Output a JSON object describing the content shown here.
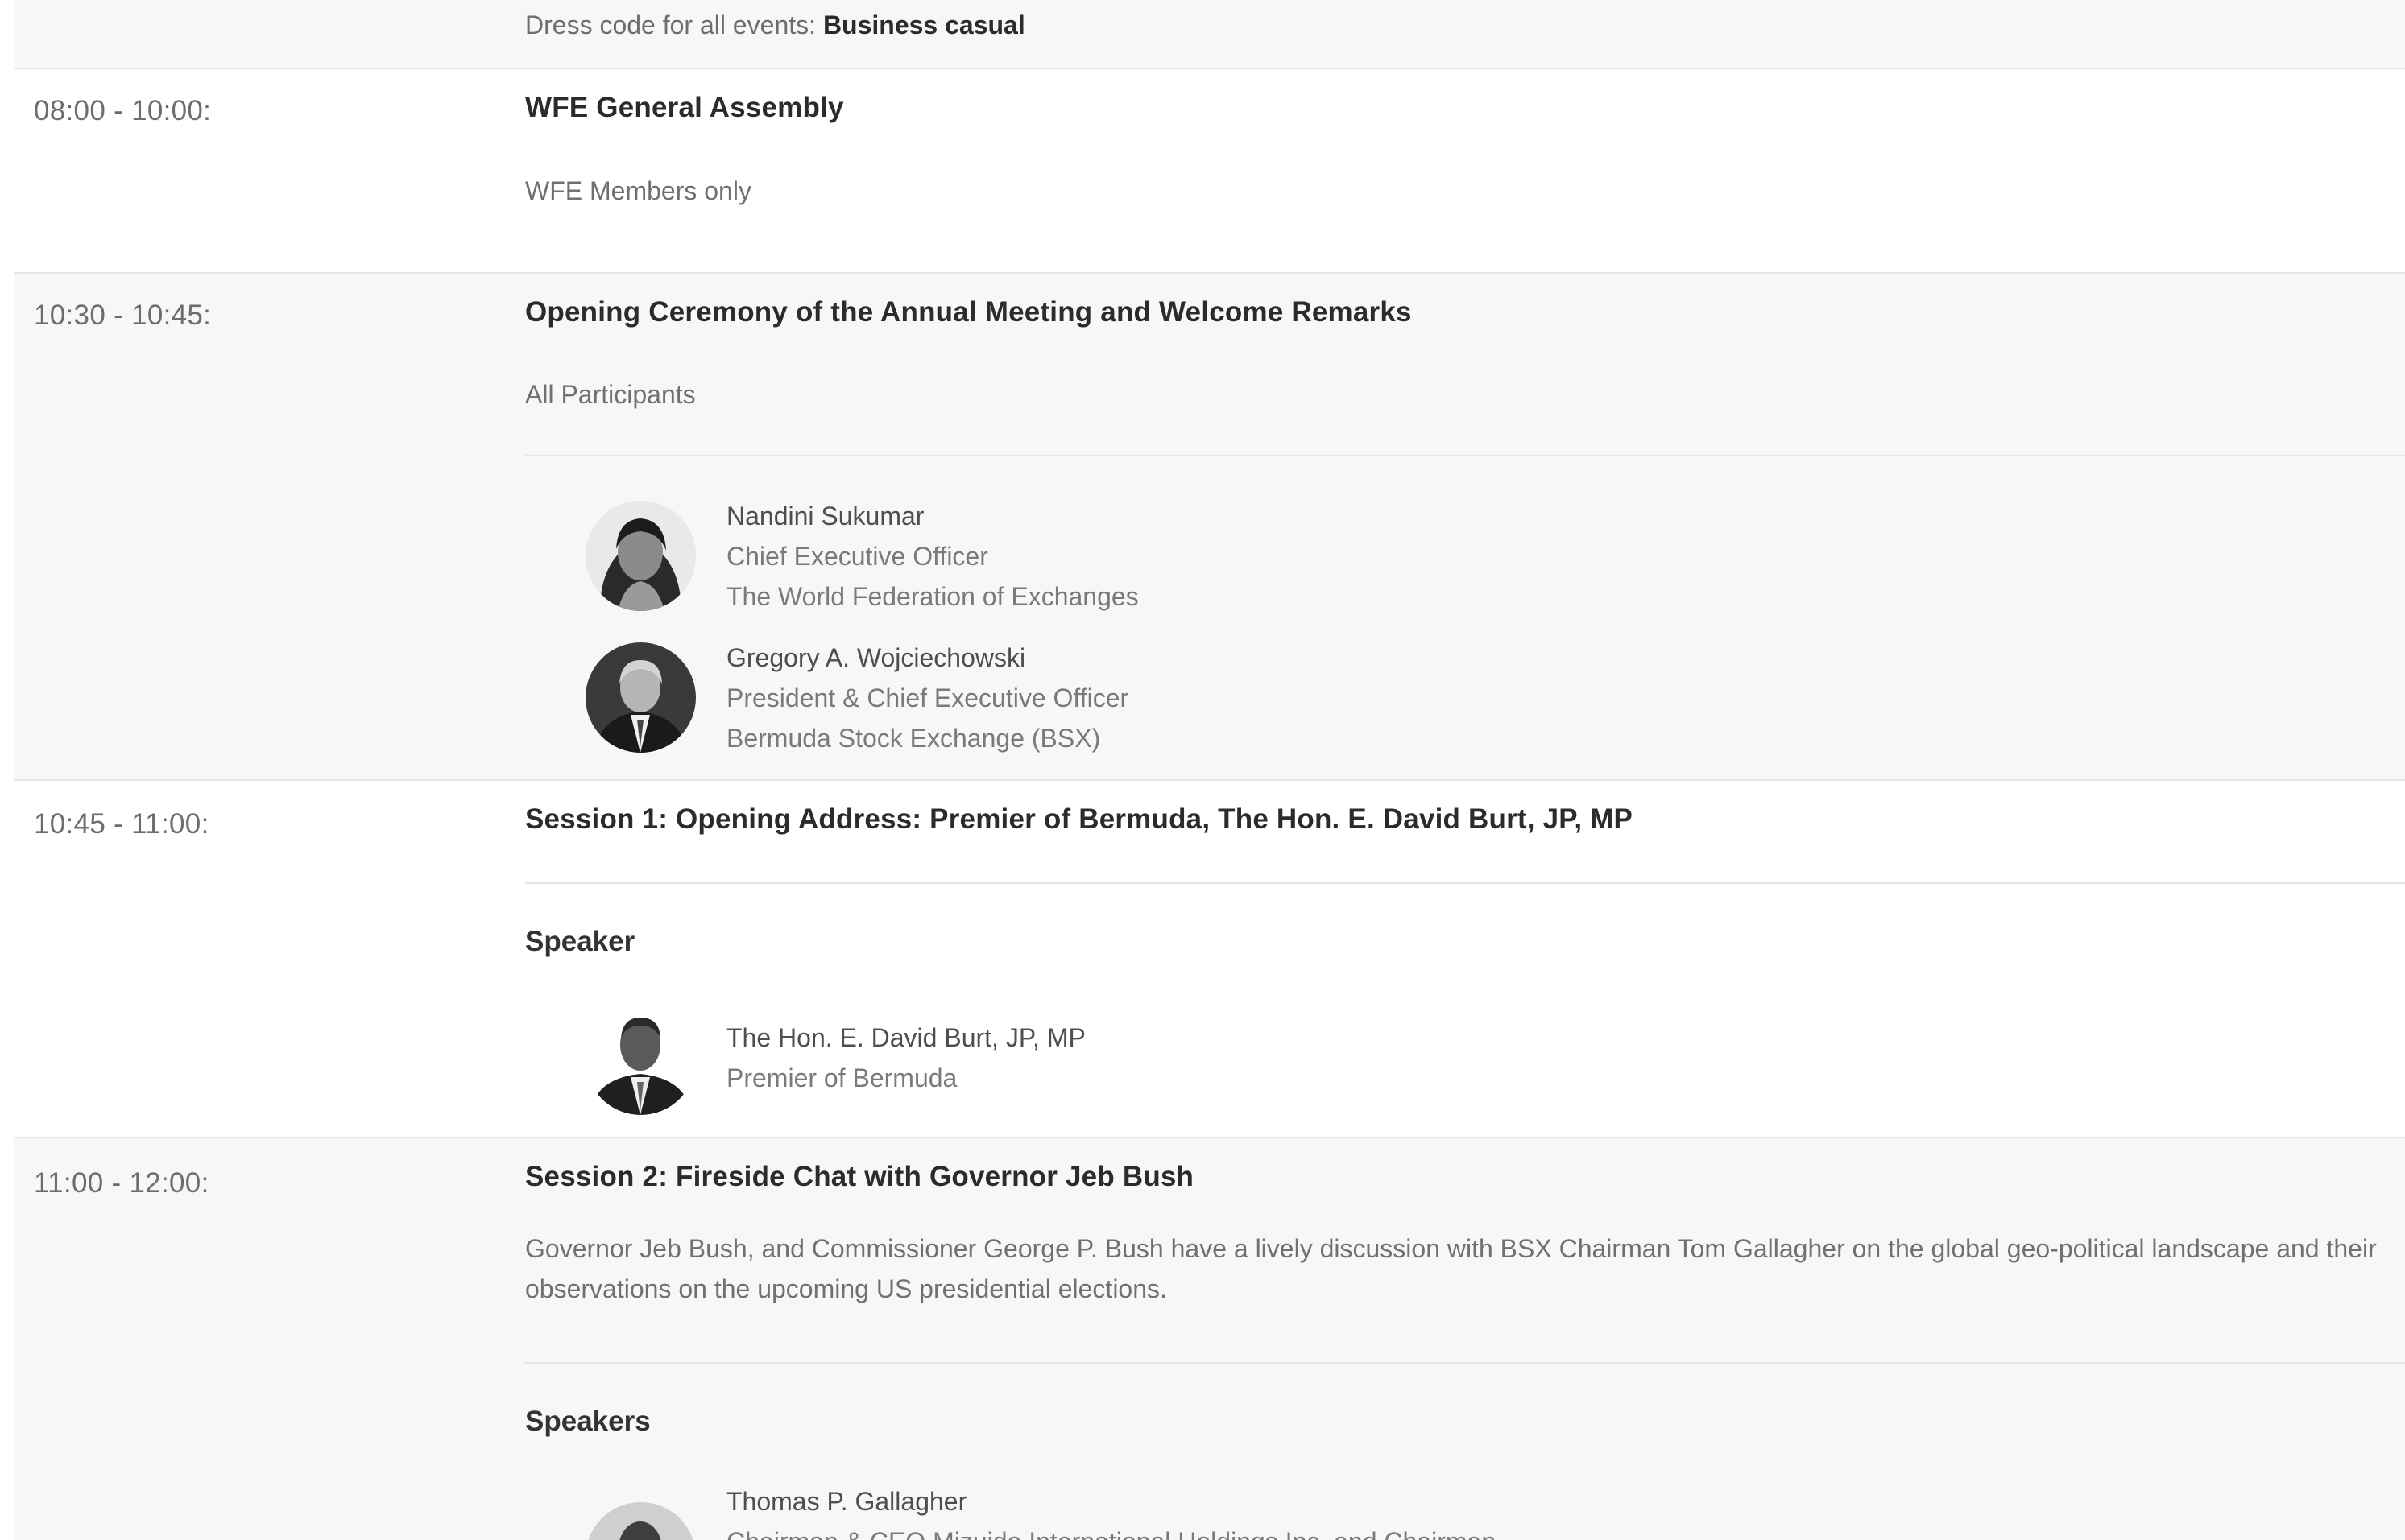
{
  "dress_code": {
    "label": "Dress code for all events: ",
    "value": "Business casual"
  },
  "sessions": [
    {
      "time": "08:00 - 10:00:",
      "title": "WFE General Assembly",
      "description": "WFE Members only"
    },
    {
      "time": "10:30 - 10:45:",
      "title": "Opening Ceremony of the Annual Meeting and Welcome Remarks",
      "description": "All Participants",
      "speakers": [
        {
          "name": "Nandini Sukumar",
          "role": "Chief Executive Officer",
          "org": "The World Federation of Exchanges"
        },
        {
          "name": "Gregory A. Wojciechowski",
          "role": "President & Chief Executive Officer",
          "org": "Bermuda Stock Exchange (BSX)"
        }
      ]
    },
    {
      "time": "10:45 - 11:00:",
      "title": "Session 1: Opening Address: Premier of Bermuda, The Hon. E. David Burt, JP, MP",
      "section_label": "Speaker",
      "speakers": [
        {
          "name": "The Hon. E. David Burt, JP, MP",
          "role": "Premier of Bermuda"
        }
      ]
    },
    {
      "time": "11:00 - 12:00:",
      "title": "Session 2: Fireside Chat with Governor Jeb Bush",
      "description": "Governor Jeb Bush, and Commissioner George P. Bush have a lively discussion with BSX Chairman Tom Gallagher on the global geo-political landscape and their observations on the upcoming US presidential elections.",
      "section_label": "Speakers",
      "speakers": [
        {
          "name": "Thomas P.  Gallagher",
          "role": "Chairman & CEO Mizuido International Holdings Inc. and Chairman"
        }
      ]
    }
  ]
}
